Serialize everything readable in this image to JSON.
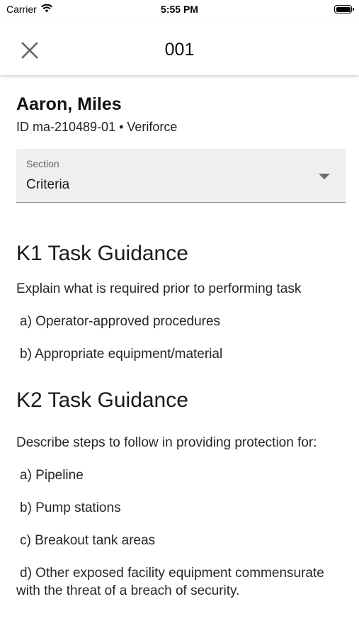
{
  "status_bar": {
    "carrier": "Carrier",
    "time": "5:55 PM",
    "wifi_icon": "wifi-icon",
    "battery_icon": "battery-icon"
  },
  "app_bar": {
    "title": "001",
    "close_icon": "close-icon"
  },
  "person": {
    "name": "Aaron, Miles",
    "id_line": "ID ma-210489-01 • Veriforce"
  },
  "section_select": {
    "label": "Section",
    "value": "Criteria",
    "arrow_icon": "dropdown-arrow-icon"
  },
  "guidance": {
    "k1": {
      "heading": "K1 Task Guidance",
      "intro": "Explain what is required prior to performing task",
      "items": [
        "a) Operator-approved procedures",
        "b) Appropriate equipment/material"
      ]
    },
    "k2": {
      "heading": "K2 Task Guidance",
      "intro": "Describe steps to follow in providing protection for:",
      "items": [
        "a) Pipeline",
        "b) Pump stations",
        "c) Breakout tank areas",
        "d) Other exposed facility equipment commensurate with the threat of a breach of security."
      ]
    }
  },
  "colors": {
    "background": "#ffffff",
    "select_background": "#efefef",
    "text": "#1c1c1c"
  }
}
